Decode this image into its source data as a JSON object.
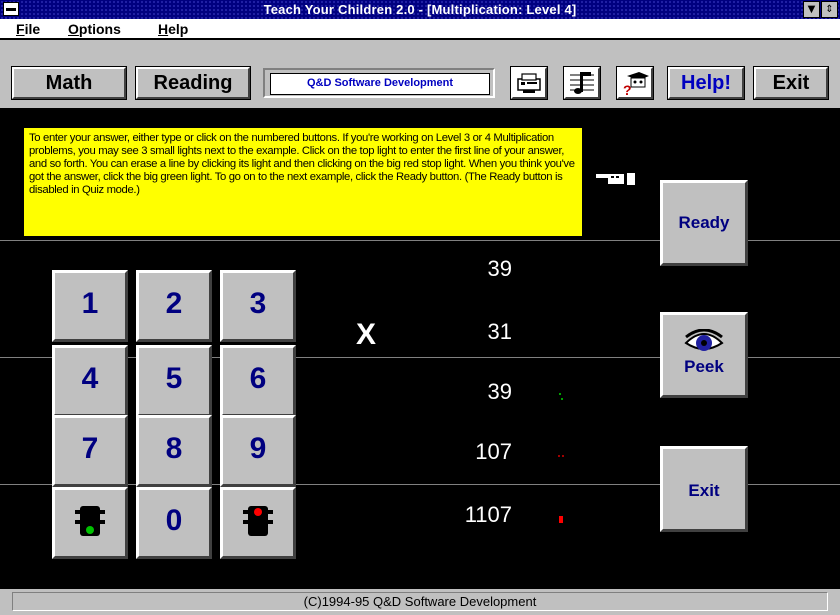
{
  "window": {
    "title": "Teach Your Children 2.0 - [Multiplication: Level 4]",
    "minimize_glyph": "▼",
    "restore_glyph": "⇕"
  },
  "menu": [
    {
      "label": "File"
    },
    {
      "label": "Options"
    },
    {
      "label": "Help"
    }
  ],
  "toolbar": {
    "math_label": "Math",
    "reading_label": "Reading",
    "brand_label": "Q&D Software Development",
    "help_label": "Help!",
    "exit_label": "Exit",
    "icons": [
      "printer-icon",
      "music-notes-icon",
      "graduate-icon"
    ]
  },
  "instructions": "To enter your answer, either type or click on the numbered buttons. If you're working on Level 3 or 4 Multiplication problems, you may see 3 small lights next to the example. Click on the top light to enter the first line of your answer, and so forth. You can erase a line by clicking its light and then clicking on the big red stop light. When you think you've got the answer, click the big green light.  To go on to the next example, click the Ready button. (The Ready button is disabled in Quiz mode.)",
  "keypad": [
    "1",
    "2",
    "3",
    "4",
    "5",
    "6",
    "7",
    "8",
    "9",
    "go-light",
    "0",
    "stop-light"
  ],
  "problem": {
    "multiplicand": "39",
    "operator": "X",
    "multiplier": "31",
    "lines": [
      "39",
      "107",
      "1107"
    ],
    "light_colors": [
      "#00a000",
      "#a00000",
      "#ff0000"
    ]
  },
  "side": {
    "ready_label": "Ready",
    "peek_label": "Peek",
    "exit_label": "Exit"
  },
  "status": "(C)1994-95 Q&D Software Development",
  "colors": {
    "title_bar": "#000080",
    "instructions_bg": "#ffff00",
    "key_text": "#000080",
    "button_face": "#c0c0c0"
  }
}
